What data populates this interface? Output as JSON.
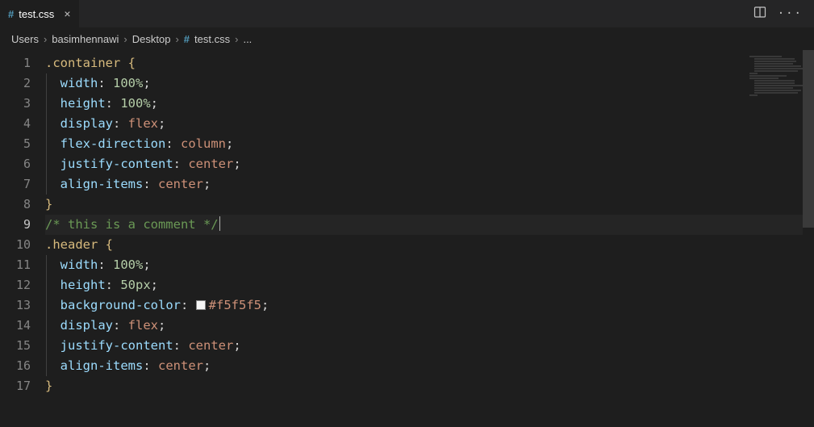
{
  "tab": {
    "icon": "#",
    "filename": "test.css"
  },
  "breadcrumbs": {
    "parts": [
      "Users",
      "basimhennawi",
      "Desktop"
    ],
    "file_icon": "#",
    "filename": "test.css",
    "trailing": "..."
  },
  "active_line": 9,
  "lines": [
    {
      "n": 1,
      "indent": 0,
      "tokens": [
        [
          "selector",
          ".container"
        ],
        [
          "space",
          " "
        ],
        [
          "brace",
          "{"
        ]
      ]
    },
    {
      "n": 2,
      "indent": 1,
      "tokens": [
        [
          "prop",
          "width"
        ],
        [
          "punct",
          ": "
        ],
        [
          "num",
          "100%"
        ],
        [
          "punct",
          ";"
        ]
      ]
    },
    {
      "n": 3,
      "indent": 1,
      "tokens": [
        [
          "prop",
          "height"
        ],
        [
          "punct",
          ": "
        ],
        [
          "num",
          "100%"
        ],
        [
          "punct",
          ";"
        ]
      ]
    },
    {
      "n": 4,
      "indent": 1,
      "tokens": [
        [
          "prop",
          "display"
        ],
        [
          "punct",
          ": "
        ],
        [
          "const",
          "flex"
        ],
        [
          "punct",
          ";"
        ]
      ]
    },
    {
      "n": 5,
      "indent": 1,
      "tokens": [
        [
          "prop",
          "flex-direction"
        ],
        [
          "punct",
          ": "
        ],
        [
          "const",
          "column"
        ],
        [
          "punct",
          ";"
        ]
      ]
    },
    {
      "n": 6,
      "indent": 1,
      "tokens": [
        [
          "prop",
          "justify-content"
        ],
        [
          "punct",
          ": "
        ],
        [
          "const",
          "center"
        ],
        [
          "punct",
          ";"
        ]
      ]
    },
    {
      "n": 7,
      "indent": 1,
      "tokens": [
        [
          "prop",
          "align-items"
        ],
        [
          "punct",
          ": "
        ],
        [
          "const",
          "center"
        ],
        [
          "punct",
          ";"
        ]
      ]
    },
    {
      "n": 8,
      "indent": 0,
      "tokens": [
        [
          "brace",
          "}"
        ]
      ]
    },
    {
      "n": 9,
      "indent": 0,
      "cursor_after": true,
      "tokens": [
        [
          "comment",
          "/* this is a comment */"
        ]
      ]
    },
    {
      "n": 10,
      "indent": 0,
      "tokens": [
        [
          "selector",
          ".header"
        ],
        [
          "space",
          " "
        ],
        [
          "brace",
          "{"
        ]
      ]
    },
    {
      "n": 11,
      "indent": 1,
      "tokens": [
        [
          "prop",
          "width"
        ],
        [
          "punct",
          ": "
        ],
        [
          "num",
          "100%"
        ],
        [
          "punct",
          ";"
        ]
      ]
    },
    {
      "n": 12,
      "indent": 1,
      "tokens": [
        [
          "prop",
          "height"
        ],
        [
          "punct",
          ": "
        ],
        [
          "num",
          "50px"
        ],
        [
          "punct",
          ";"
        ]
      ]
    },
    {
      "n": 13,
      "indent": 1,
      "tokens": [
        [
          "prop",
          "background-color"
        ],
        [
          "punct",
          ": "
        ],
        [
          "swatch",
          "#f5f5f5"
        ],
        [
          "hex",
          "#f5f5f5"
        ],
        [
          "punct",
          ";"
        ]
      ]
    },
    {
      "n": 14,
      "indent": 1,
      "tokens": [
        [
          "prop",
          "display"
        ],
        [
          "punct",
          ": "
        ],
        [
          "const",
          "flex"
        ],
        [
          "punct",
          ";"
        ]
      ]
    },
    {
      "n": 15,
      "indent": 1,
      "tokens": [
        [
          "prop",
          "justify-content"
        ],
        [
          "punct",
          ": "
        ],
        [
          "const",
          "center"
        ],
        [
          "punct",
          ";"
        ]
      ]
    },
    {
      "n": 16,
      "indent": 1,
      "tokens": [
        [
          "prop",
          "align-items"
        ],
        [
          "punct",
          ": "
        ],
        [
          "const",
          "center"
        ],
        [
          "punct",
          ";"
        ]
      ]
    },
    {
      "n": 17,
      "indent": 0,
      "tokens": [
        [
          "brace",
          "}"
        ]
      ]
    }
  ]
}
